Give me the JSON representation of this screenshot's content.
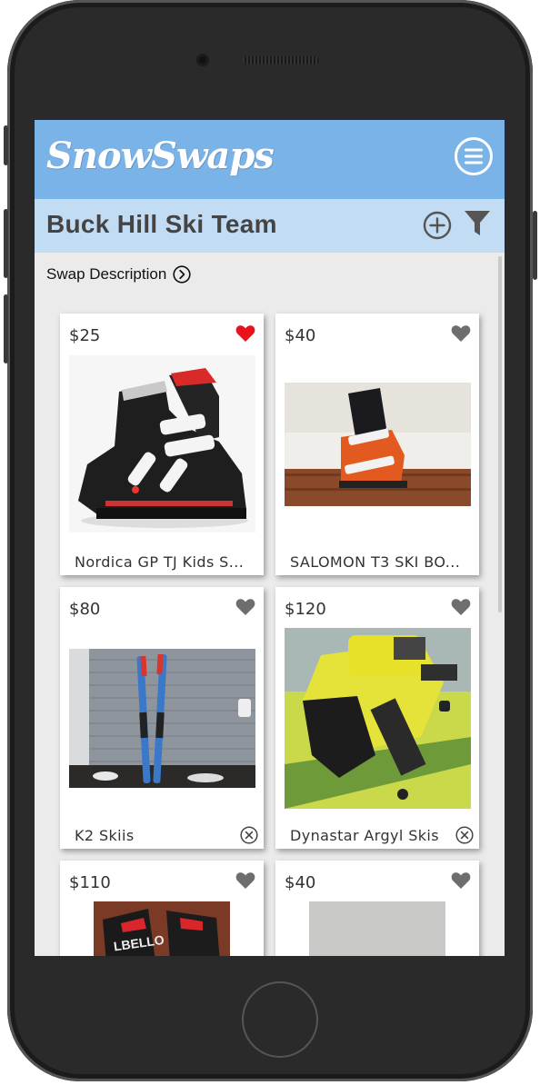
{
  "app": {
    "logo_text": "SnowSwaps",
    "accent_color": "#7ab3e8",
    "subheader_color": "#c2dcf4"
  },
  "header": {
    "menu_icon": "hamburger-circle-icon"
  },
  "team": {
    "title": "Buck Hill Ski Team",
    "add_icon": "plus-circle-icon",
    "filter_icon": "filter-icon"
  },
  "description": {
    "label": "Swap Description",
    "icon": "chevron-right-circle-icon"
  },
  "items": [
    {
      "price": "$25",
      "title": "Nordica GP TJ Kids S...",
      "favorited": true,
      "removable": false,
      "photo": "black-red-ski-boots"
    },
    {
      "price": "$40",
      "title": "SALOMON T3 SKI BO...",
      "favorited": false,
      "removable": false,
      "photo": "orange-ski-boot-on-wood-floor"
    },
    {
      "price": "$80",
      "title": "K2 Skiis",
      "favorited": false,
      "removable": true,
      "photo": "skis-against-siding"
    },
    {
      "price": "$120",
      "title": "Dynastar Argyl Skis",
      "favorited": false,
      "removable": true,
      "photo": "yellow-ski-binding"
    },
    {
      "price": "$110",
      "title": "",
      "favorited": false,
      "removable": false,
      "photo": "dalbello-boots"
    },
    {
      "price": "$40",
      "title": "",
      "favorited": false,
      "removable": false,
      "photo": "gray-item"
    }
  ]
}
